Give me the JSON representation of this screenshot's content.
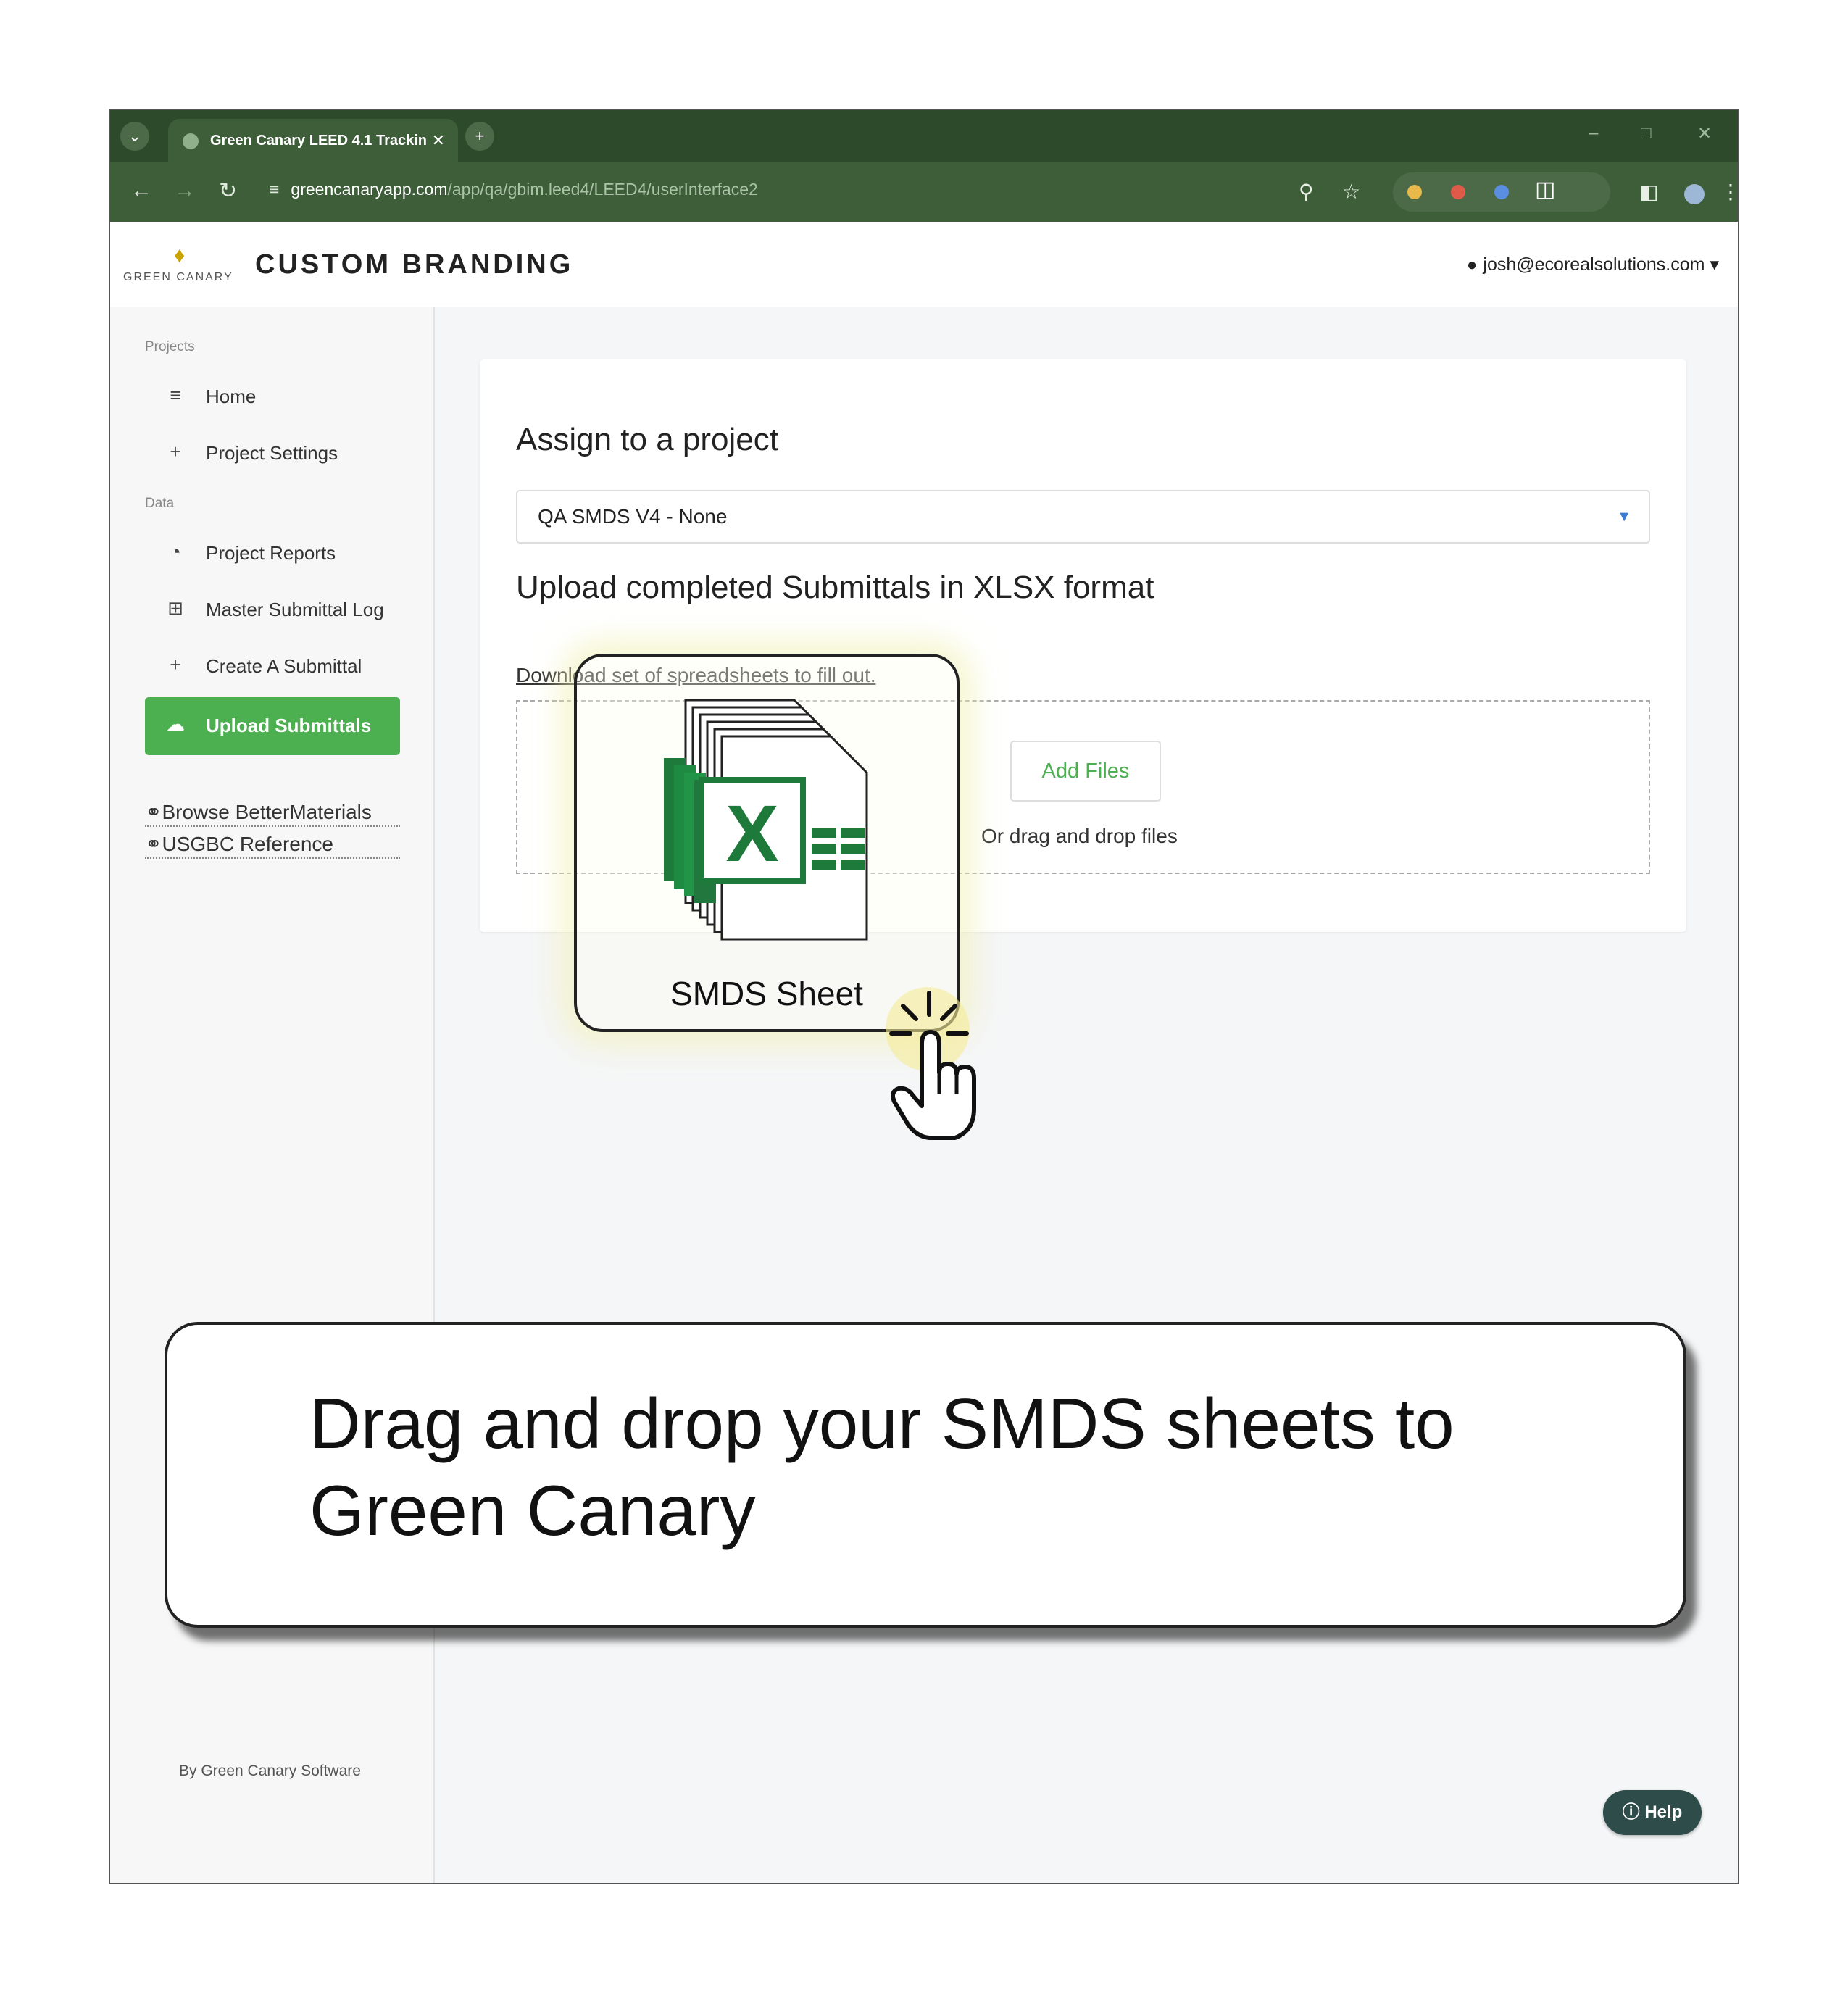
{
  "browser": {
    "tab_title": "Green Canary LEED 4.1 Trackin",
    "url_host": "greencanaryapp.com",
    "url_path": "/app/qa/gbim.leed4/LEED4/userInterface2"
  },
  "header": {
    "logo_text": "GREEN CANARY",
    "brand": "CUSTOM BRANDING",
    "user_email": "josh@ecorealsolutions.com"
  },
  "sidebar": {
    "section_projects": "Projects",
    "section_data": "Data",
    "items": [
      {
        "label": "Home",
        "icon": "list-icon"
      },
      {
        "label": "Project Settings",
        "icon": "plus-icon"
      },
      {
        "label": "Project Reports",
        "icon": "pie-chart-icon"
      },
      {
        "label": "Master Submittal Log",
        "icon": "table-icon"
      },
      {
        "label": "Create A Submittal",
        "icon": "plus-icon"
      },
      {
        "label": "Upload Submittals",
        "icon": "cloud-upload-icon",
        "active": true
      }
    ],
    "links": [
      {
        "label": "Browse BetterMaterials",
        "icon": "link-icon"
      },
      {
        "label": "USGBC Reference",
        "icon": "link-icon"
      }
    ],
    "byline": "By Green Canary Software"
  },
  "main": {
    "assign_heading": "Assign to a project",
    "project_select": "QA SMDS V4 - None",
    "upload_heading": "Upload completed Submittals in XLSX format",
    "download_link": "Download set of spreadsheets to fill out.",
    "add_files": "Add Files",
    "drop_hint": "Or drag and drop files"
  },
  "drag_ghost": {
    "label": "SMDS Sheet",
    "icon": "excel-file-icon"
  },
  "callout": {
    "text": "Drag and drop your SMDS sheets to Green Canary"
  },
  "help": {
    "label": "Help"
  }
}
